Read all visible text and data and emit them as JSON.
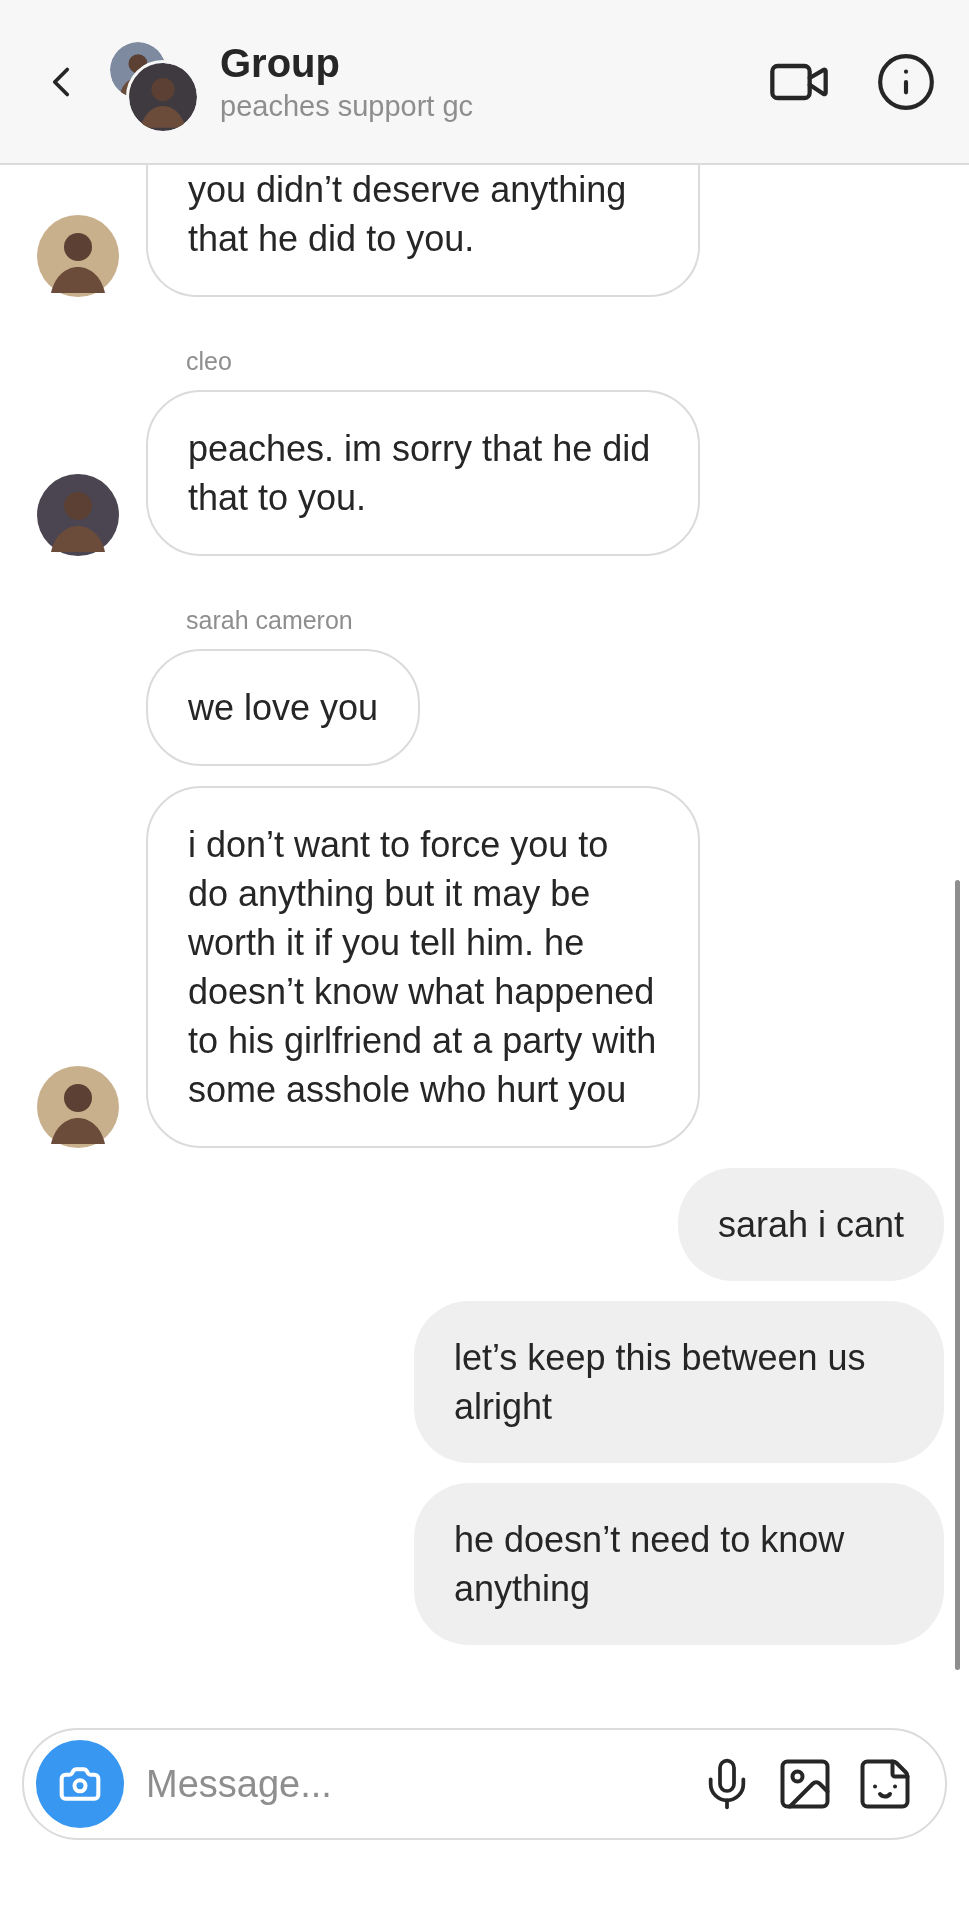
{
  "header": {
    "title": "Group",
    "subtitle": "peaches support gc"
  },
  "messages": [
    {
      "kind": "incoming",
      "text": "you didn’t deserve anything that he did to you.",
      "avatar": true
    },
    {
      "kind": "incoming",
      "sender": "cleo",
      "text": "peaches. im sorry that he did that to you.",
      "avatar": true
    },
    {
      "kind": "incoming",
      "sender": "sarah cameron",
      "text": "we love you",
      "avatar": false
    },
    {
      "kind": "incoming",
      "text": "i don’t want to force you to do anything but it may be worth it if you tell him. he doesn’t know what happened to his girlfriend at a party with some asshole who hurt you",
      "avatar": true
    },
    {
      "kind": "outgoing",
      "text": "sarah i cant"
    },
    {
      "kind": "outgoing",
      "text": "let’s keep this between us alright"
    },
    {
      "kind": "outgoing",
      "text": "he doesn’t need to know anything"
    }
  ],
  "composer": {
    "placeholder": "Message..."
  }
}
